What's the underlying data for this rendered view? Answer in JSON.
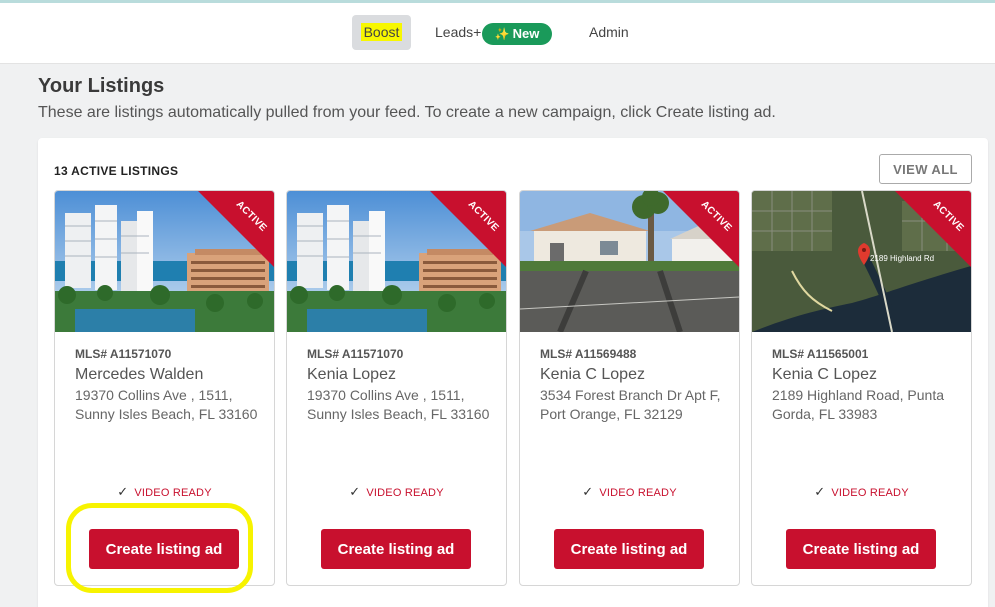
{
  "nav": {
    "items": [
      {
        "label": "Boost",
        "active": true
      },
      {
        "label": "Leads+"
      },
      {
        "label": "Admin"
      }
    ],
    "new_badge": "New",
    "new_badge_icon": "sparkles-icon"
  },
  "header": {
    "title": "Your Listings",
    "subtitle": "These are listings automatically pulled from your feed. To create a new campaign, click Create listing ad."
  },
  "listings_panel": {
    "count_label": "13 ACTIVE LISTINGS",
    "view_all_label": "VIEW ALL"
  },
  "cards": [
    {
      "status": "ACTIVE",
      "mls": "MLS# A11571070",
      "agent": "Mercedes Walden",
      "address": "19370 Collins Ave , 1511, Sunny Isles Beach, FL 33160",
      "video_status": "VIDEO READY",
      "button_label": "Create listing ad"
    },
    {
      "status": "ACTIVE",
      "mls": "MLS# A11571070",
      "agent": "Kenia Lopez",
      "address": "19370 Collins Ave , 1511, Sunny Isles Beach, FL 33160",
      "video_status": "VIDEO READY",
      "button_label": "Create listing ad"
    },
    {
      "status": "ACTIVE",
      "mls": "MLS# A11569488",
      "agent": "Kenia C Lopez",
      "address": "3534 Forest Branch Dr Apt F, Port Orange, FL 32129",
      "video_status": "VIDEO READY",
      "button_label": "Create listing ad"
    },
    {
      "status": "ACTIVE",
      "mls": "MLS# A11565001",
      "agent": "Kenia C Lopez",
      "address": "2189 Highland Road, Punta Gorda, FL 33983",
      "video_status": "VIDEO READY",
      "button_label": "Create listing ad",
      "map_label": "2189 Highland Rd"
    }
  ],
  "colors": {
    "accent_red": "#c8102e",
    "badge_green": "#1a9a5a",
    "highlight_yellow": "#f7f300"
  }
}
